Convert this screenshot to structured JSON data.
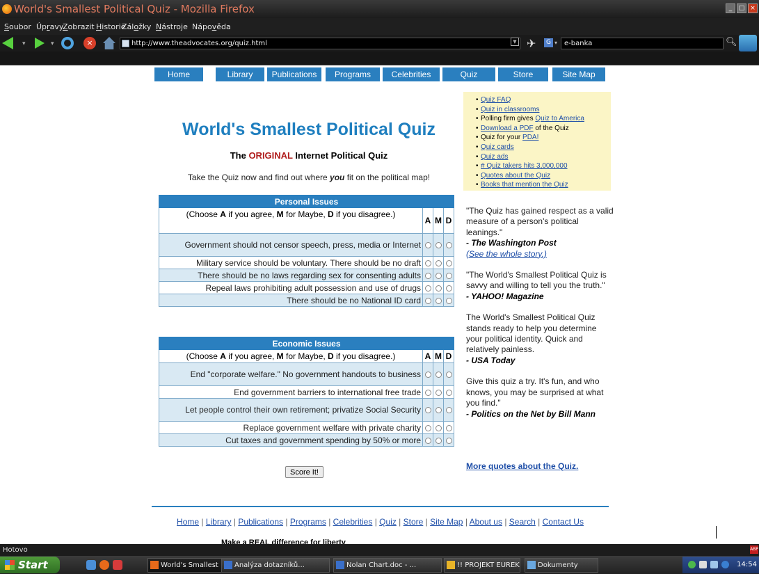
{
  "window": {
    "title": "World's Smallest Political Quiz - Mozilla Firefox"
  },
  "menubar": {
    "items": [
      {
        "pre": "",
        "u": "S",
        "post": "oubor"
      },
      {
        "pre": "Úp",
        "u": "r",
        "post": "avy"
      },
      {
        "pre": "",
        "u": "Z",
        "post": "obrazit"
      },
      {
        "pre": "",
        "u": "H",
        "post": "istorie"
      },
      {
        "pre": "Zál",
        "u": "o",
        "post": "žky"
      },
      {
        "pre": "",
        "u": "N",
        "post": "ástroje"
      },
      {
        "pre": "Nápo",
        "u": "v",
        "post": "ěda"
      }
    ]
  },
  "toolbar": {
    "url": "http://www.theadvocates.org/quiz.html",
    "search_value": "e-banka",
    "search_engine_letter": "G"
  },
  "site_nav": [
    "Home",
    "Library",
    "Publications",
    "Programs",
    "Celebrities",
    "Quiz",
    "Store",
    "Site Map"
  ],
  "quiz": {
    "title": "World's Smallest Political Quiz",
    "subtitle_pre": "The ",
    "subtitle_highlight": "ORIGINAL",
    "subtitle_post": " Internet Political Quiz",
    "intro_pre": "Take the Quiz now and find out where ",
    "intro_em": "you",
    "intro_post": " fit on the political map!",
    "choose_parts": [
      "(Choose ",
      "A",
      " if you agree, ",
      "M",
      " for Maybe, ",
      "D",
      " if you disagree.)"
    ],
    "answer_letters": [
      "A",
      "M",
      "D"
    ],
    "personal": {
      "heading": "Personal Issues",
      "questions": [
        "Government should not censor speech, press, media or Internet",
        "Military service should be voluntary. There should be no draft",
        "There should be no laws regarding sex for consenting adults",
        "Repeal laws prohibiting adult possession and use of drugs",
        "There should be no National ID card"
      ]
    },
    "economic": {
      "heading": "Economic Issues",
      "questions": [
        "End \"corporate welfare.\" No government handouts to business",
        "End government barriers to international free trade",
        "Let people control their own retirement; privatize Social Security",
        "Replace government welfare with private charity",
        "Cut taxes and government spending by 50% or more"
      ]
    },
    "score_button": "Score It!"
  },
  "side_links": [
    {
      "pre": "",
      "link": "Quiz FAQ",
      "post": ""
    },
    {
      "pre": "",
      "link": "Quiz in classrooms",
      "post": ""
    },
    {
      "pre": "Polling firm gives ",
      "link": "Quiz to America",
      "post": ""
    },
    {
      "pre": "",
      "link": "Download a PDF",
      "post": " of the Quiz"
    },
    {
      "pre": "Quiz for your ",
      "link": "PDA!",
      "post": ""
    },
    {
      "pre": "",
      "link": "Quiz cards",
      "post": ""
    },
    {
      "pre": "",
      "link": "Quiz ads",
      "post": ""
    },
    {
      "pre": "",
      "link": "# Quiz takers hits 3,000,000",
      "post": ""
    },
    {
      "pre": "",
      "link": "Quotes about the Quiz",
      "post": ""
    },
    {
      "pre": "",
      "link": "Books that mention the Quiz",
      "post": ""
    }
  ],
  "quotes": [
    {
      "text": "\"The Quiz has gained respect as a valid measure of a person's political leanings.\"",
      "source": "- The Washington Post",
      "link": "(See the whole story.)"
    },
    {
      "text": "\"The World's Smallest Political Quiz is savvy and willing to tell you the truth.\"",
      "source": "- YAHOO! Magazine",
      "link": ""
    },
    {
      "text": "The World's Smallest Political Quiz stands ready to help you determine your political identity. Quick and relatively painless.",
      "source": " - USA Today",
      "link": ""
    },
    {
      "text": "Give this quiz a try. It's fun, and who knows, you may be surprised at what you find.\"",
      "source": "- Politics on the Net by Bill Mann",
      "link": ""
    }
  ],
  "more_quotes": "More quotes about the Quiz.",
  "footer_links": [
    "Home",
    "Library",
    "Publications",
    "Programs",
    "Celebrities",
    "Quiz",
    "Store",
    "Site Map",
    "About us",
    "Search",
    "Contact Us"
  ],
  "footer_clip_text": "Make a REAL difference for liberty",
  "status": "Hotovo",
  "taskbar": {
    "start": "Start",
    "tasks": [
      "World's Smallest ...",
      "Analýza dotazníků...",
      "Nolan Chart.doc - ...",
      "!! PROJEKT EUREK...",
      "Dokumenty"
    ],
    "clock": "14:54"
  },
  "colors": {
    "accent_blue": "#2a7fbf",
    "title_blue": "#1f7fbf",
    "original_red": "#b01c1c",
    "table_row_tint": "#d9e9f3",
    "sidebar_yellow": "#fbf5c6"
  }
}
